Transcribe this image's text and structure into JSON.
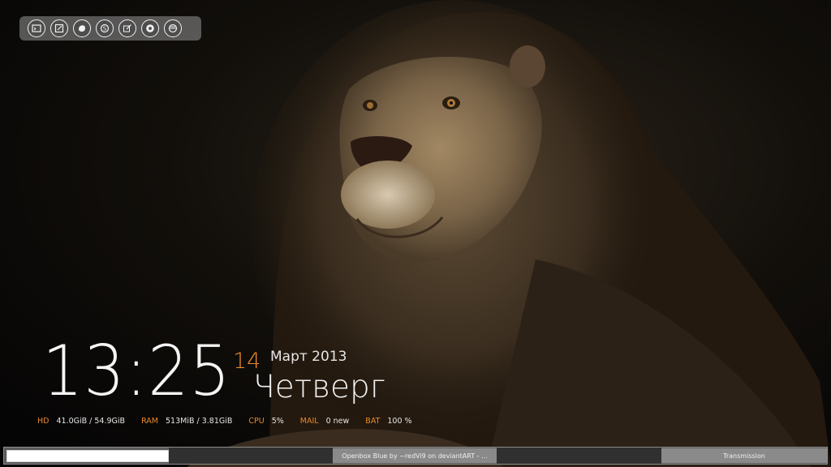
{
  "wallpaper": {
    "subject": "lion portrait on dark background"
  },
  "dock": {
    "launchers": [
      {
        "icon": "terminal-icon"
      },
      {
        "icon": "text-editor-icon"
      },
      {
        "icon": "firefox-icon"
      },
      {
        "icon": "skype-icon"
      },
      {
        "icon": "graphics-editor-icon"
      },
      {
        "icon": "chromium-icon"
      },
      {
        "icon": "settings-icon"
      }
    ]
  },
  "clock": {
    "time": "13:25",
    "day": "14",
    "month_year": "Март 2013",
    "weekday": "Четверг"
  },
  "stats": {
    "hd": {
      "label": "HD",
      "value": "41.0GiB / 54.9GiB"
    },
    "ram": {
      "label": "RAM",
      "value": "513MiB / 3.81GiB"
    },
    "cpu": {
      "label": "CPU",
      "value": "5%"
    },
    "mail": {
      "label": "MAIL",
      "value": "0 new"
    },
    "bat": {
      "label": "BAT",
      "value": "100 %"
    }
  },
  "taskbar": {
    "tasks": [
      {
        "label": "Openbox Blue by ~redVi9 on deviantART - ..."
      },
      {
        "label": "Transmission"
      }
    ]
  },
  "colors": {
    "accent": "#e8892a",
    "text": "#f5f5f5",
    "taskbar": "#5a5a5a"
  }
}
